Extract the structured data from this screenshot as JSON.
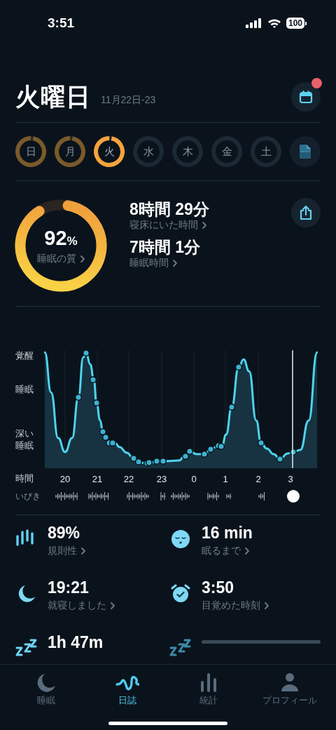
{
  "status_bar": {
    "time": "3:51",
    "battery": "100"
  },
  "header": {
    "title": "火曜日",
    "date_range": "11月22日-23",
    "calendar_badge": true
  },
  "days": [
    {
      "label": "日",
      "has_data": true,
      "selected": false
    },
    {
      "label": "月",
      "has_data": true,
      "selected": false
    },
    {
      "label": "火",
      "has_data": true,
      "selected": true
    },
    {
      "label": "水",
      "has_data": false,
      "selected": false
    },
    {
      "label": "木",
      "has_data": false,
      "selected": false
    },
    {
      "label": "金",
      "has_data": false,
      "selected": false
    },
    {
      "label": "土",
      "has_data": false,
      "selected": false
    }
  ],
  "summary": {
    "quality": {
      "value": "92",
      "unit": "%",
      "label": "睡眠の質",
      "level": 0.92
    },
    "metrics": [
      {
        "value": "8時間 29分",
        "label": "寝床にいた時間"
      },
      {
        "value": "7時間 1分",
        "label": "睡眠時間"
      }
    ]
  },
  "chart": {
    "y_labels": [
      "覚醒",
      "睡眠",
      "深い睡眠"
    ],
    "time_row_label": "時間",
    "time_labels": [
      "20",
      "21",
      "22",
      "23",
      "0",
      "1",
      "2",
      "3"
    ],
    "snore_row_label": "いびき"
  },
  "stats": [
    {
      "kind": "value",
      "value": "89%",
      "label": "規則性"
    },
    {
      "kind": "value",
      "value": "16 min",
      "label": "眠るまで"
    },
    {
      "kind": "value",
      "value": "19:21",
      "label": "就寝しました"
    },
    {
      "kind": "value",
      "value": "3:50",
      "label": "目覚めた時刻"
    },
    {
      "kind": "value",
      "value": "1h 47m"
    },
    {
      "kind": "loading"
    }
  ],
  "tabs": [
    {
      "label": "睡眠",
      "selected": false
    },
    {
      "label": "日誌",
      "selected": true
    },
    {
      "label": "統計",
      "selected": false
    },
    {
      "label": "プロフィール",
      "selected": false
    }
  ]
}
